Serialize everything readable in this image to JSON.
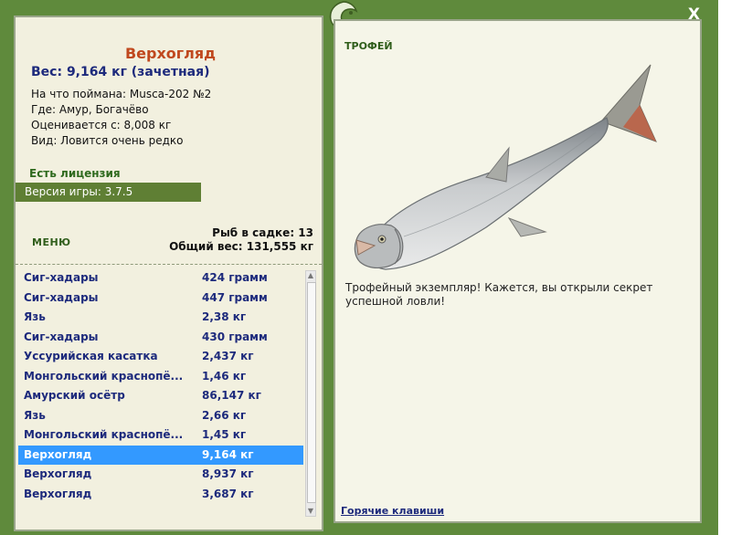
{
  "header": {
    "close_glyph": "X"
  },
  "fish": {
    "title": "Верхогляд",
    "weight_line": "Вес: 9,164 кг (зачетная)",
    "info": [
      "На что поймана: Musca-202 №2",
      "Где: Амур, Богачёво",
      "Оценивается с: 8,008 кг",
      "Вид: Ловится очень редко"
    ],
    "license": "Есть лицензия",
    "version": "Версия игры: 3.7.5"
  },
  "keep": {
    "menu": "МЕНЮ",
    "count": "Рыб в садке: 13",
    "weight": "Общий вес: 131,555 кг",
    "items": [
      {
        "name": "Сиг-хадары",
        "weight": "424 грамм"
      },
      {
        "name": "Сиг-хадары",
        "weight": "447 грамм"
      },
      {
        "name": "Язь",
        "weight": "2,38 кг"
      },
      {
        "name": "Сиг-хадары",
        "weight": "430 грамм"
      },
      {
        "name": "Уссурийская касатка",
        "weight": "2,437 кг"
      },
      {
        "name": "Монгольский краснопё...",
        "weight": "1,46 кг"
      },
      {
        "name": "Амурский осётр",
        "weight": "86,147 кг"
      },
      {
        "name": "Язь",
        "weight": "2,66 кг"
      },
      {
        "name": "Монгольский краснопё...",
        "weight": "1,45 кг"
      },
      {
        "name": "Верхогляд",
        "weight": "9,164 кг"
      },
      {
        "name": "Верхогляд",
        "weight": "8,937 кг"
      },
      {
        "name": "Верхогляд",
        "weight": "3,687 кг"
      }
    ],
    "selected_index": 9
  },
  "trophy": {
    "label": "ТРОФЕЙ",
    "text": "Трофейный экземпляр! Кажется, вы открыли секрет успешной ловли!",
    "hotkeys": "Горячие клавиши"
  },
  "colors": {
    "frame": "#5f8a3c",
    "selection": "#3399ff",
    "title": "#c0481e",
    "link": "#1d2a7c"
  }
}
